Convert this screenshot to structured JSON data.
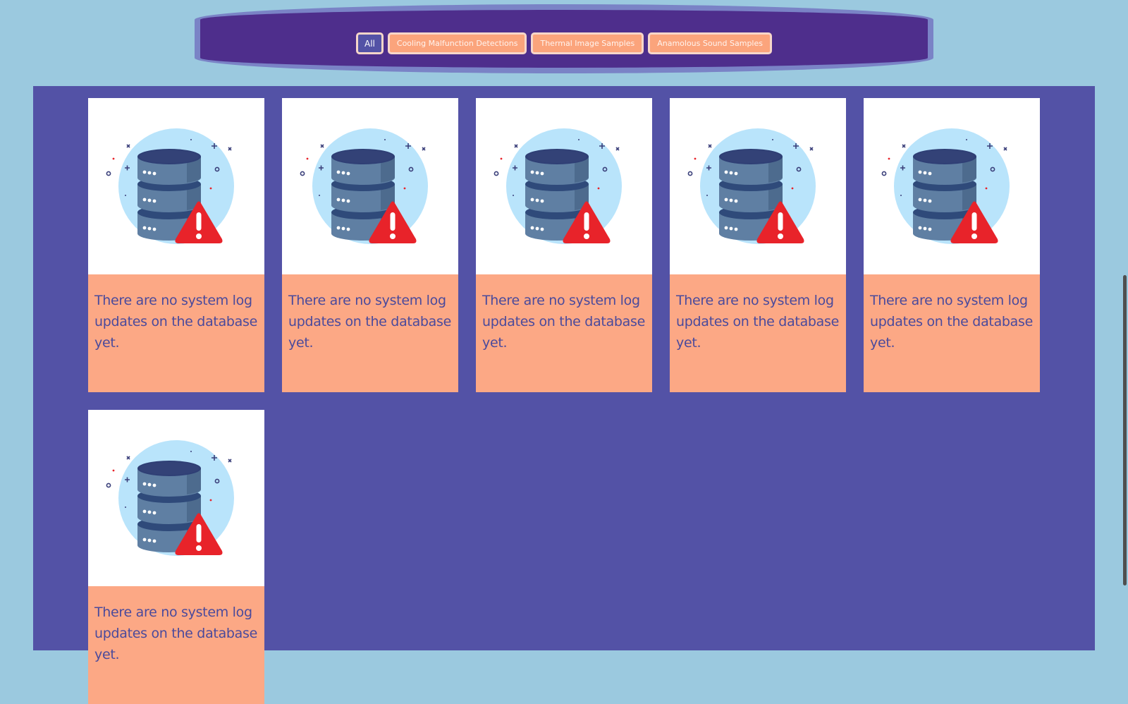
{
  "filters": [
    {
      "label": "All",
      "active": true
    },
    {
      "label": "Cooling Malfunction Detections",
      "active": false
    },
    {
      "label": "Thermal Image Samples",
      "active": false
    },
    {
      "label": "Anamolous Sound Samples",
      "active": false
    }
  ],
  "cards": [
    {
      "message": "There are no system log updates on the database yet.",
      "icon": "database-warning-icon"
    },
    {
      "message": "There are no system log updates on the database yet.",
      "icon": "database-warning-icon"
    },
    {
      "message": "There are no system log updates on the database yet.",
      "icon": "database-warning-icon"
    },
    {
      "message": "There are no system log updates on the database yet.",
      "icon": "database-warning-icon"
    },
    {
      "message": "There are no system log updates on the database yet.",
      "icon": "database-warning-icon"
    },
    {
      "message": "There are no system log updates on the database yet.",
      "icon": "database-warning-icon"
    }
  ],
  "colors": {
    "page_background": "#9bc9df",
    "filter_bar": "#4e2e8c",
    "filter_bar_border": "#7a83c6",
    "filter_button": "#fba47c",
    "filter_button_active": "#5352a6",
    "panel": "#5352a6",
    "card_footer": "#fca885",
    "card_text": "#4a4a9c",
    "warning": "#e8232a"
  }
}
